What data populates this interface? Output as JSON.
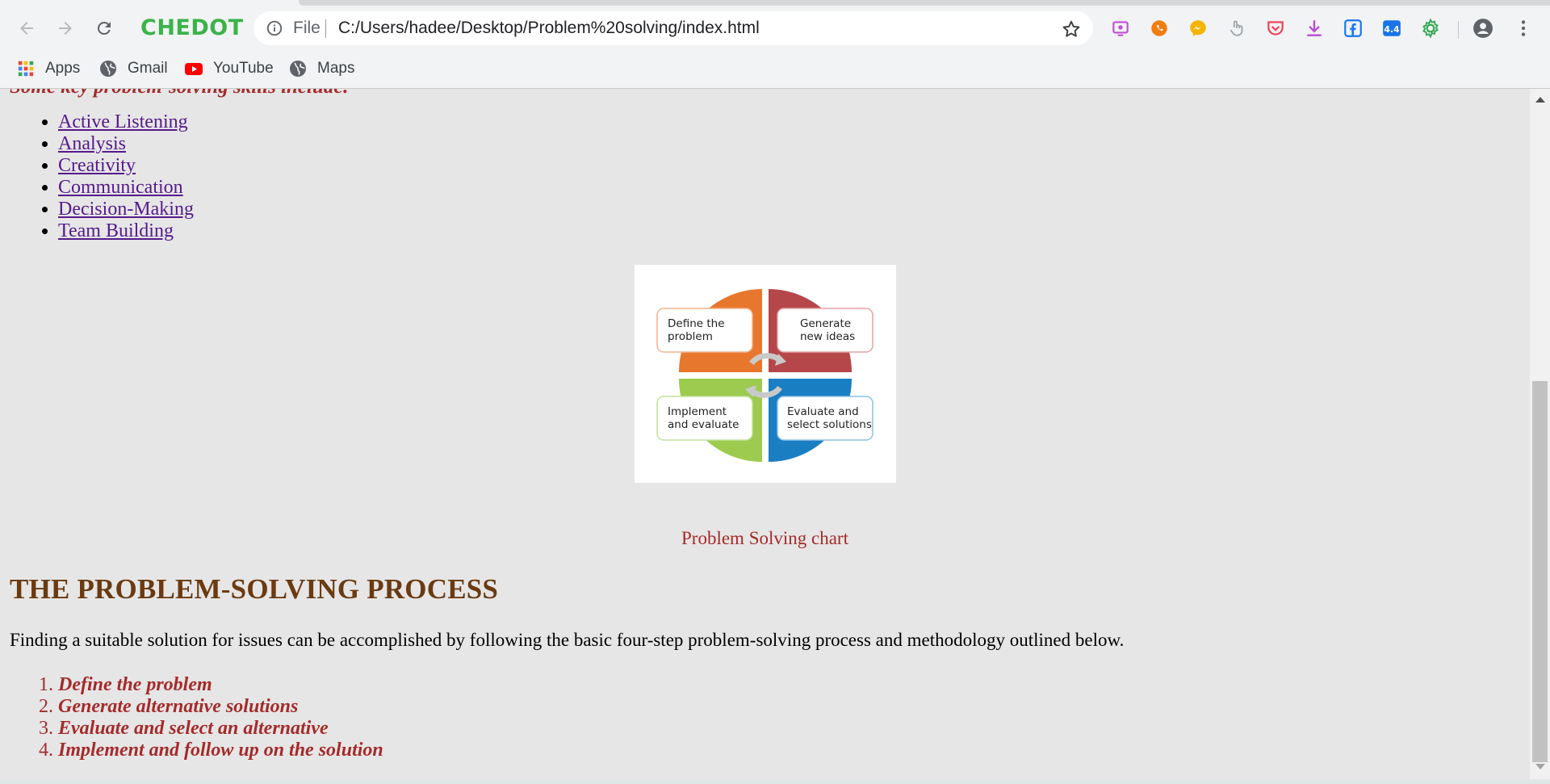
{
  "browser": {
    "brand": "CHEDOT",
    "brand_color": "#3cb34a",
    "address": {
      "scheme_label": "File",
      "url": "C:/Users/hadee/Desktop/Problem%20solving/index.html"
    },
    "extensions": [
      "screen-recorder-icon",
      "chat-bubble-icon",
      "messenger-icon",
      "touch-icon",
      "pocket-icon",
      "download-icon",
      "facebook-icon",
      "version-badge-icon",
      "puzzle-gear-icon"
    ],
    "extension_badge": "4.4",
    "bookmarks": [
      {
        "label": "Apps",
        "icon": "apps-grid-icon"
      },
      {
        "label": "Gmail",
        "icon": "globe-icon"
      },
      {
        "label": "YouTube",
        "icon": "youtube-icon"
      },
      {
        "label": "Maps",
        "icon": "globe-icon"
      }
    ]
  },
  "page": {
    "intro": "Some key problem-solving skills include:",
    "skills": [
      "Active Listening",
      "Analysis",
      "Creativity",
      "Communication",
      "Decision-Making",
      "Team Building"
    ],
    "figure": {
      "quadrants": [
        {
          "label_line1": "Define the",
          "label_line2": "problem",
          "color": "#e8772e"
        },
        {
          "label_line1": "Generate",
          "label_line2": "new ideas",
          "color": "#b5474a"
        },
        {
          "label_line1": "Implement",
          "label_line2": "and evaluate",
          "color": "#9ccb4f"
        },
        {
          "label_line1": "Evaluate and",
          "label_line2": "select solutions",
          "color": "#1a7ec2"
        }
      ]
    },
    "caption": "Problem Solving chart",
    "heading": "THE PROBLEM-SOLVING PROCESS",
    "paragraph": "Finding a suitable solution for issues can be accomplished by following the basic four-step problem-solving process and methodology outlined below.",
    "steps": [
      "Define the problem",
      "Generate alternative solutions",
      "Evaluate and select an alternative",
      "Implement and follow up on the solution"
    ]
  }
}
